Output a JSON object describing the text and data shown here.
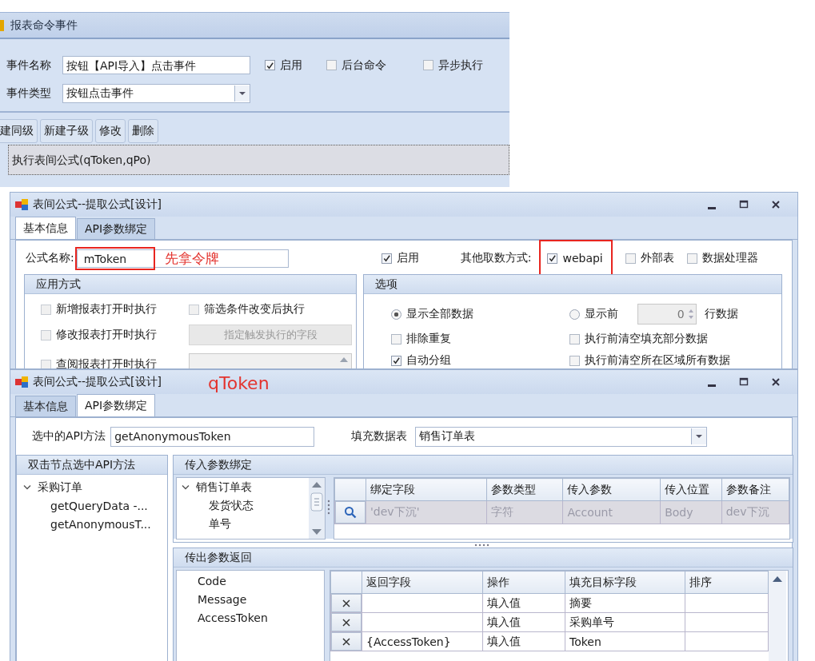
{
  "event_panel": {
    "title": "报表命令事件",
    "name_label": "事件名称",
    "name_value": "按钮【API导入】点击事件",
    "options": [
      {
        "label": "启用",
        "checked": true
      },
      {
        "label": "后台命令",
        "checked": false
      },
      {
        "label": "异步执行",
        "checked": false
      }
    ],
    "type_label": "事件类型",
    "type_value": "按钮点击事件",
    "toolbar": [
      "建同级",
      "新建子级",
      "修改",
      "删除"
    ],
    "commands": [
      {
        "text": "执行表间公式(qToken,qPo)",
        "selected": true
      }
    ]
  },
  "formula_window_1": {
    "title": "表间公式--提取公式[设计]",
    "tabs": [
      {
        "label": "基本信息",
        "selected": true
      },
      {
        "label": "API参数绑定",
        "selected": false
      }
    ],
    "formula_label": "公式名称:",
    "formula_value": "mToken",
    "formula_highlighted": true,
    "formula_note": "先拿令牌",
    "enable": {
      "label": "启用",
      "checked": true
    },
    "source_label": "其他取数方式:",
    "sources": [
      {
        "label": "webapi",
        "checked": true,
        "highlighted": true
      },
      {
        "label": "外部表",
        "checked": false,
        "highlighted": false
      },
      {
        "label": "数据处理器",
        "checked": false,
        "highlighted": false
      }
    ],
    "apply_group": {
      "title": "应用方式",
      "items": [
        {
          "kind": "checkbox",
          "label": "新增报表打开时执行",
          "checked": false
        },
        {
          "kind": "checkbox",
          "label": "筛选条件改变后执行",
          "checked": false
        },
        {
          "kind": "checkbox",
          "label": "修改报表打开时执行",
          "checked": false
        },
        {
          "kind": "button",
          "label": "指定触发执行的字段",
          "disabled": true
        },
        {
          "kind": "checkbox",
          "label": "查阅报表打开时执行",
          "checked": false
        },
        {
          "kind": "listbox"
        }
      ]
    },
    "options_group": {
      "title": "选项",
      "items": [
        {
          "kind": "radio",
          "label": "显示全部数据",
          "selected": true
        },
        {
          "kind": "count",
          "label": "显示前",
          "selected": false,
          "value": "0",
          "suffix": "行数据"
        },
        {
          "kind": "checkbox",
          "label": "排除重复",
          "checked": false
        },
        {
          "kind": "checkbox",
          "label": "执行前清空填充部分数据",
          "checked": false
        },
        {
          "kind": "checkbox",
          "label": "自动分组",
          "checked": true
        },
        {
          "kind": "checkbox",
          "label": "执行前清空所在区域所有数据",
          "checked": false
        }
      ]
    }
  },
  "formula_window_2": {
    "title": "表间公式--提取公式[设计]",
    "annotation": "qToken",
    "tabs": [
      {
        "label": "基本信息",
        "selected": false
      },
      {
        "label": "API参数绑定",
        "selected": true
      }
    ],
    "method_label": "选中的API方法",
    "method_value": "getAnonymousToken",
    "table_label": "填充数据表",
    "table_value": "销售订单表",
    "api_tree": {
      "title": "双击节点选中API方法",
      "nodes": [
        {
          "label": "采购订单",
          "expanded": true,
          "children": [
            {
              "label": "getQueryData -..."
            },
            {
              "label": "getAnonymousT..."
            }
          ]
        }
      ]
    },
    "input_binding": {
      "title": "传入参数绑定",
      "tree": [
        {
          "label": "销售订单表",
          "expanded": true,
          "children": [
            {
              "label": "发货状态"
            },
            {
              "label": "单号"
            }
          ]
        }
      ],
      "columns": [
        "绑定字段",
        "参数类型",
        "传入参数",
        "传入位置",
        "参数备注"
      ],
      "rows": [
        {
          "disabled": true,
          "cells": [
            "'dev下沉'",
            "字符",
            "Account",
            "Body",
            "dev下沉"
          ]
        }
      ]
    },
    "output_return": {
      "title": "传出参数返回",
      "fields": [
        "Code",
        "Message",
        "AccessToken"
      ],
      "columns": [
        "返回字段",
        "操作",
        "填充目标字段",
        "排序"
      ],
      "rows": [
        {
          "cells": [
            "",
            "填入值",
            "摘要",
            ""
          ]
        },
        {
          "cells": [
            "",
            "填入值",
            "采购单号",
            ""
          ]
        },
        {
          "cells": [
            "{AccessToken}",
            "填入值",
            "Token",
            ""
          ]
        }
      ]
    }
  }
}
